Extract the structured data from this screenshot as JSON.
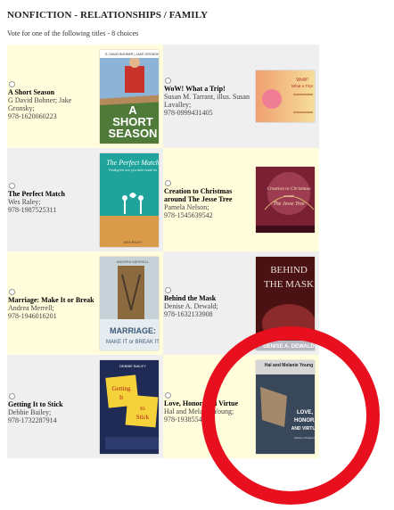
{
  "page": {
    "title": "NONFICTION - RELATIONSHIPS / FAMILY",
    "subtitle": "Vote for one of the following titles - 8 choices"
  },
  "books": [
    {
      "title": "A Short Season",
      "authors": "G David Bohner; Jake Gronsky;",
      "isbn": "978-1620060223",
      "cover": {
        "top": "G. DAVID BOHNER | JAKE GRONSKY",
        "main": "A SHORT SEASON",
        "color": "#6a8fb5"
      }
    },
    {
      "title": "WoW! What a Trip!",
      "authors": "Susan M. Tarrant, illus. Susan Lavalley;",
      "isbn": "978-0999431405",
      "cover": {
        "main": "WoW! What a Trip!",
        "color": "#f5d08a"
      }
    },
    {
      "title": "The Perfect Match",
      "authors": "Wes Raley;",
      "isbn": "978-1987525311",
      "cover": {
        "main": "The Perfect Match",
        "sub": "Finding the one you were made for",
        "color": "#2aa7a0"
      }
    },
    {
      "title": "Creation to Christmas around The Jesse Tree",
      "authors": "Pamela Nelson;",
      "isbn": "978-1545639542",
      "cover": {
        "main": "Creation to Christmas around The Jesse Tree",
        "color": "#7a2035"
      }
    },
    {
      "title": "Marriage: Make It or Break It",
      "authors": "Andrea Merrell;",
      "isbn": "978-1946016201",
      "cover": {
        "top": "ANDREA MERRELL",
        "main": "MARRIAGE: MAKE IT or BREAK IT",
        "color": "#5c6f78"
      }
    },
    {
      "title": "Behind the Mask",
      "authors": "Denise A. Dewald;",
      "isbn": "978-1632133908",
      "cover": {
        "main": "BEHIND THE MASK",
        "author": "DENISE A. DEWALD",
        "color": "#5a1a1a"
      }
    },
    {
      "title": "Getting It to Stick",
      "authors": "Debbie Bailey;",
      "isbn": "978-1732287914",
      "cover": {
        "top": "DEBBIE BAILEY",
        "main": "Getting It to Stick",
        "color": "#1f2a55"
      }
    },
    {
      "title": "Love, Honor, and Virtue",
      "authors": "Hal and Melanie Young;",
      "isbn": "978-1938554",
      "cover": {
        "top": "Hal and Melanie Young",
        "main": "LOVE, HONOR, AND VIRTUE",
        "sub": "Gaining or Regaining a Biblical Attitude Toward Sexuality",
        "color": "#39475a"
      }
    }
  ],
  "overlay": {
    "annotation_color": "#e8101e"
  }
}
